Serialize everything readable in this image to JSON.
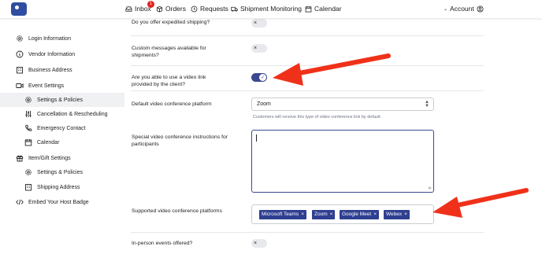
{
  "nav": {
    "inbox": "Inbox",
    "inbox_badge": "1",
    "orders": "Orders",
    "requests": "Requests",
    "shipment_monitoring": "Shipment Monitoring",
    "calendar": "Calendar",
    "account": "Account"
  },
  "sidebar": {
    "items": [
      {
        "label": "Login Information",
        "icon": "gear-icon"
      },
      {
        "label": "Vendor Information",
        "icon": "info-icon"
      },
      {
        "label": "Business Address",
        "icon": "building-icon"
      },
      {
        "label": "Event Settings",
        "icon": "video-icon"
      },
      {
        "label": "Settings & Policies",
        "icon": "gear-icon"
      },
      {
        "label": "Cancellation & Rescheduling",
        "icon": "sliders-icon"
      },
      {
        "label": "Emergency Contact",
        "icon": "phone-icon"
      },
      {
        "label": "Calendar",
        "icon": "calendar-icon"
      },
      {
        "label": "Item/Gift Settings",
        "icon": "gift-icon"
      },
      {
        "label": "Settings & Policies",
        "icon": "gear-icon"
      },
      {
        "label": "Shipping Address",
        "icon": "building-icon"
      },
      {
        "label": "Embed Your Host Badge",
        "icon": "code-icon"
      }
    ]
  },
  "form": {
    "expedited_shipping": {
      "label": "Do you offer expedited shipping?",
      "toggle": "off"
    },
    "custom_messages": {
      "label_line1": "Custom messages available for",
      "label_line2": "shipments?",
      "toggle": "off"
    },
    "video_link": {
      "label_line1": "Are you able to use a video link",
      "label_line2": "provided by the client?",
      "toggle": "on"
    },
    "default_platform": {
      "label": "Default video conference platform",
      "value": "Zoom",
      "hint": "Customers will receive this type of video conference link by default"
    },
    "special_instructions": {
      "label_line1": "Special video conference instructions for",
      "label_line2": "participants",
      "value": ""
    },
    "supported_platforms": {
      "label": "Supported video conference platforms",
      "tags": [
        "Microsoft Teams",
        "Zoom",
        "Google Meet",
        "Webex"
      ]
    },
    "in_person": {
      "label": "In-person events offered?",
      "toggle": "off"
    }
  },
  "colors": {
    "accent": "#3b4a8f",
    "annotation_arrow": "#f0311a",
    "badge": "#e02424"
  }
}
